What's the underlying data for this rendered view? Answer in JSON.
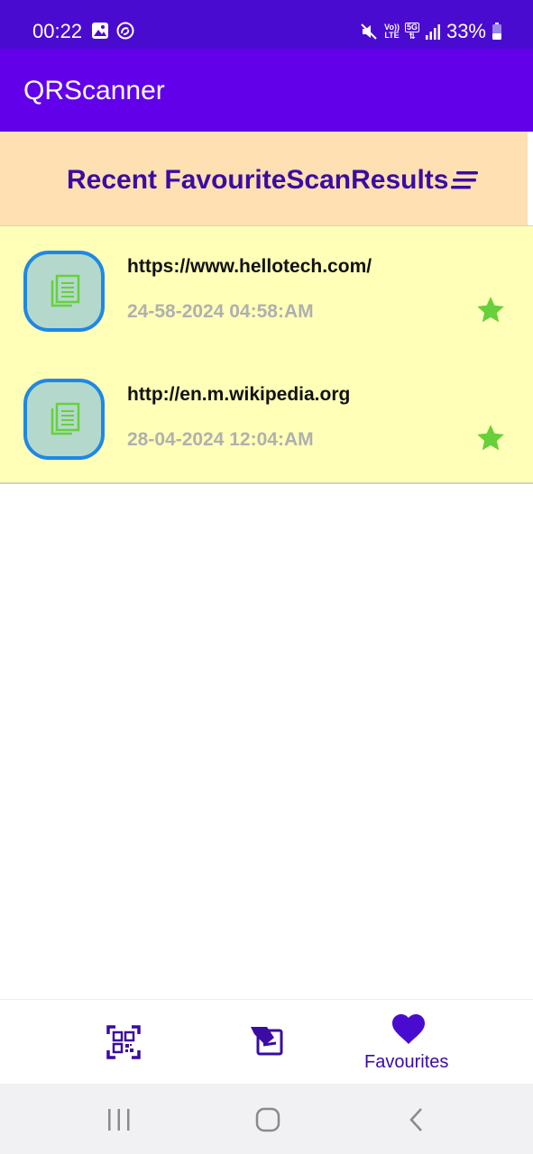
{
  "status_bar": {
    "time": "00:22",
    "left_icons": [
      "image-icon",
      "sync-icon"
    ],
    "right_icons": [
      "mute-icon",
      "volte-icon",
      "5g-icon",
      "signal-icon",
      "battery-icon"
    ],
    "volte_label_top": "Vo))",
    "volte_label_bottom": "LTE",
    "network_label": "5G",
    "battery_percent": "33%"
  },
  "app_bar": {
    "title": "QRScanner"
  },
  "header": {
    "title": "Recent FavouriteScanResults",
    "sort_icon": "sort-icon"
  },
  "results": [
    {
      "url": "https://www.hellotech.com/",
      "date": "24-58-2024 04:58:AM",
      "favourite": true
    },
    {
      "url": "http://en.m.wikipedia.org",
      "date": "28-04-2024 12:04:AM",
      "favourite": true
    }
  ],
  "bottom_nav": {
    "items": [
      {
        "icon": "qr-scan-icon",
        "label": ""
      },
      {
        "icon": "history-icon",
        "label": ""
      },
      {
        "icon": "heart-icon",
        "label": "Favourites"
      }
    ],
    "active_index": 2
  },
  "system_nav": {
    "buttons": [
      "recents-icon",
      "home-icon",
      "back-icon"
    ]
  },
  "colors": {
    "status_bar": "#4a0bd0",
    "app_bar": "#6200ea",
    "header_band": "#ffe0b2",
    "header_text": "#3a0ca3",
    "row_background": "#ffffb8",
    "badge_fill": "#b5d8cc",
    "badge_border": "#1e88e5",
    "doc_icon": "#66d13a",
    "star": "#66d13a",
    "date_text": "#b0b0b0"
  }
}
